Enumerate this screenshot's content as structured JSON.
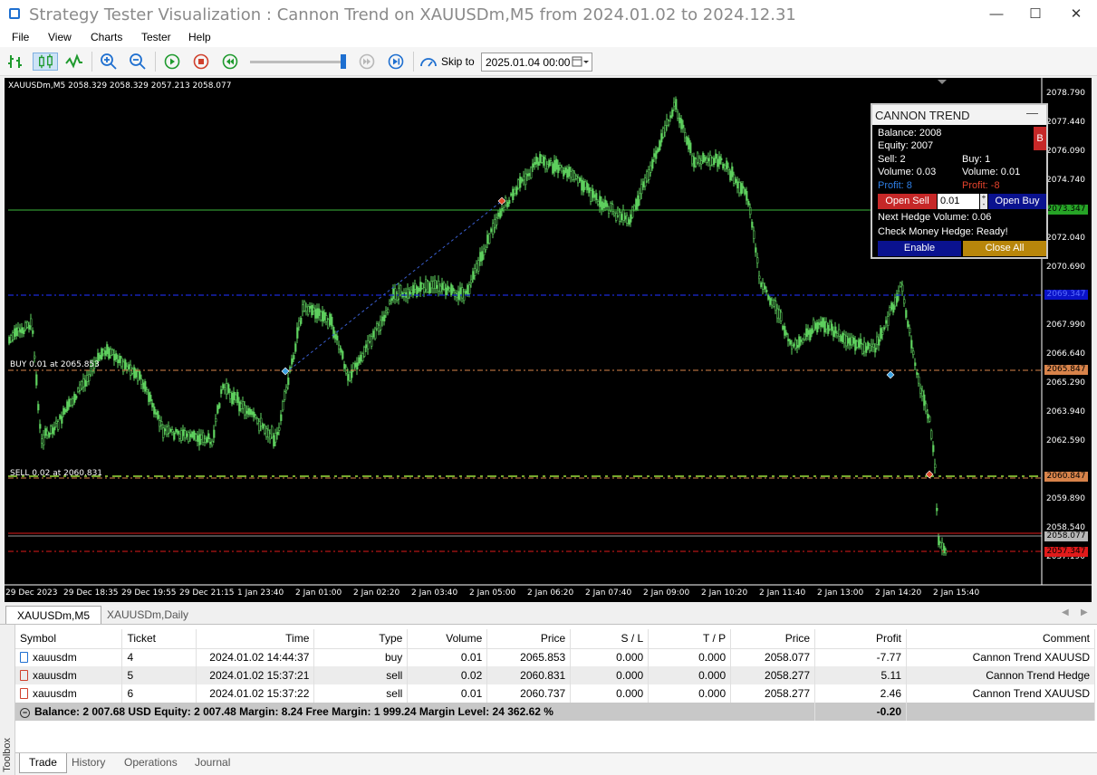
{
  "window": {
    "title": "Strategy Tester Visualization : Cannon Trend on XAUUSDm,M5 from 2024.01.02 to 2024.12.31",
    "minimize": "—",
    "maximize": "☐",
    "close": "✕"
  },
  "menu": [
    "File",
    "View",
    "Charts",
    "Tester",
    "Help"
  ],
  "toolbar": {
    "skip_label": "Skip to",
    "skip_value": "2025.01.04 00:00",
    "speed_level": 0.97
  },
  "chart": {
    "ohlc_header": "XAUUSDm,M5  2058.329 2058.329 2057.213 2058.077",
    "buy_label": "BUY 0.01 at 2065.853",
    "sell_label": "SELL 0.02 at 2060.831",
    "price_axis": [
      "2078.790",
      "2077.440",
      "2076.090",
      "2074.740",
      "2072.040",
      "2070.690",
      "2067.990",
      "2066.640",
      "2065.290",
      "2063.940",
      "2062.590",
      "2059.890",
      "2058.540",
      "2057.190"
    ],
    "price_tags": [
      {
        "text": "2073.347",
        "bg": "#26a326",
        "fg": "#000000"
      },
      {
        "text": "2069.347",
        "bg": "#0a12c8",
        "fg": "#5a6fff"
      },
      {
        "text": "2065.847",
        "bg": "#d8834a",
        "fg": "#000000"
      },
      {
        "text": "2060.847",
        "bg": "#d8834a",
        "fg": "#000000"
      },
      {
        "text": "2058.077",
        "bg": "#b8b8b8",
        "fg": "#000000"
      },
      {
        "text": "2057.347",
        "bg": "#e01a1a",
        "fg": "#000000"
      }
    ],
    "time_axis": [
      "29 Dec 2023",
      "29 Dec 18:35",
      "29 Dec 19:55",
      "29 Dec 21:15",
      "1 Jan 23:40",
      "2 Jan 01:00",
      "2 Jan 02:20",
      "2 Jan 03:40",
      "2 Jan 05:00",
      "2 Jan 06:20",
      "2 Jan 07:40",
      "2 Jan 09:00",
      "2 Jan 10:20",
      "2 Jan 11:40",
      "2 Jan 13:00",
      "2 Jan 14:20",
      "2 Jan 15:40"
    ]
  },
  "panel": {
    "title": "CANNON TREND",
    "minimize": "—",
    "balance": "Balance: 2008",
    "equity": "Equity: 2007",
    "sell_count": "Sell: 2",
    "buy_count": "Buy: 1",
    "sell_volume": "Volume: 0.03",
    "buy_volume": "Volume: 0.01",
    "sell_profit": "Profit: 8",
    "buy_profit": "Profit: -8",
    "open_sell": "Open Sell",
    "lot": "0.01",
    "open_buy": "Open Buy",
    "next_hedge": "Next Hedge Volume: 0.06",
    "check_money": "Check Money Hedge: Ready!",
    "enable": "Enable",
    "close_all": "Close All",
    "side_button": "B"
  },
  "chart_tabs": [
    "XAUUSDm,M5",
    "XAUUSDm,Daily"
  ],
  "trade_table": {
    "headers": [
      "Symbol",
      "Ticket",
      "Time",
      "Type",
      "Volume",
      "Price",
      "S / L",
      "T / P",
      "Price",
      "Profit",
      "Comment"
    ],
    "rows": [
      [
        "xauusdm",
        "4",
        "2024.01.02 14:44:37",
        "buy",
        "0.01",
        "2065.853",
        "0.000",
        "0.000",
        "2058.077",
        "-7.77",
        "Cannon Trend XAUUSD"
      ],
      [
        "xauusdm",
        "5",
        "2024.01.02 15:37:21",
        "sell",
        "0.02",
        "2060.831",
        "0.000",
        "0.000",
        "2058.277",
        "5.11",
        "Cannon Trend Hedge"
      ],
      [
        "xauusdm",
        "6",
        "2024.01.02 15:37:22",
        "sell",
        "0.01",
        "2060.737",
        "0.000",
        "0.000",
        "2058.277",
        "2.46",
        "Cannon Trend XAUUSD"
      ]
    ],
    "summary": "Balance: 2 007.68 USD  Equity: 2 007.48  Margin: 8.24  Free Margin: 1 999.24  Margin Level: 24 362.62 %",
    "summary_profit": "-0.20"
  },
  "toolbox_label": "Toolbox",
  "bottom_tabs": [
    "Trade",
    "History",
    "Operations",
    "Journal"
  ]
}
